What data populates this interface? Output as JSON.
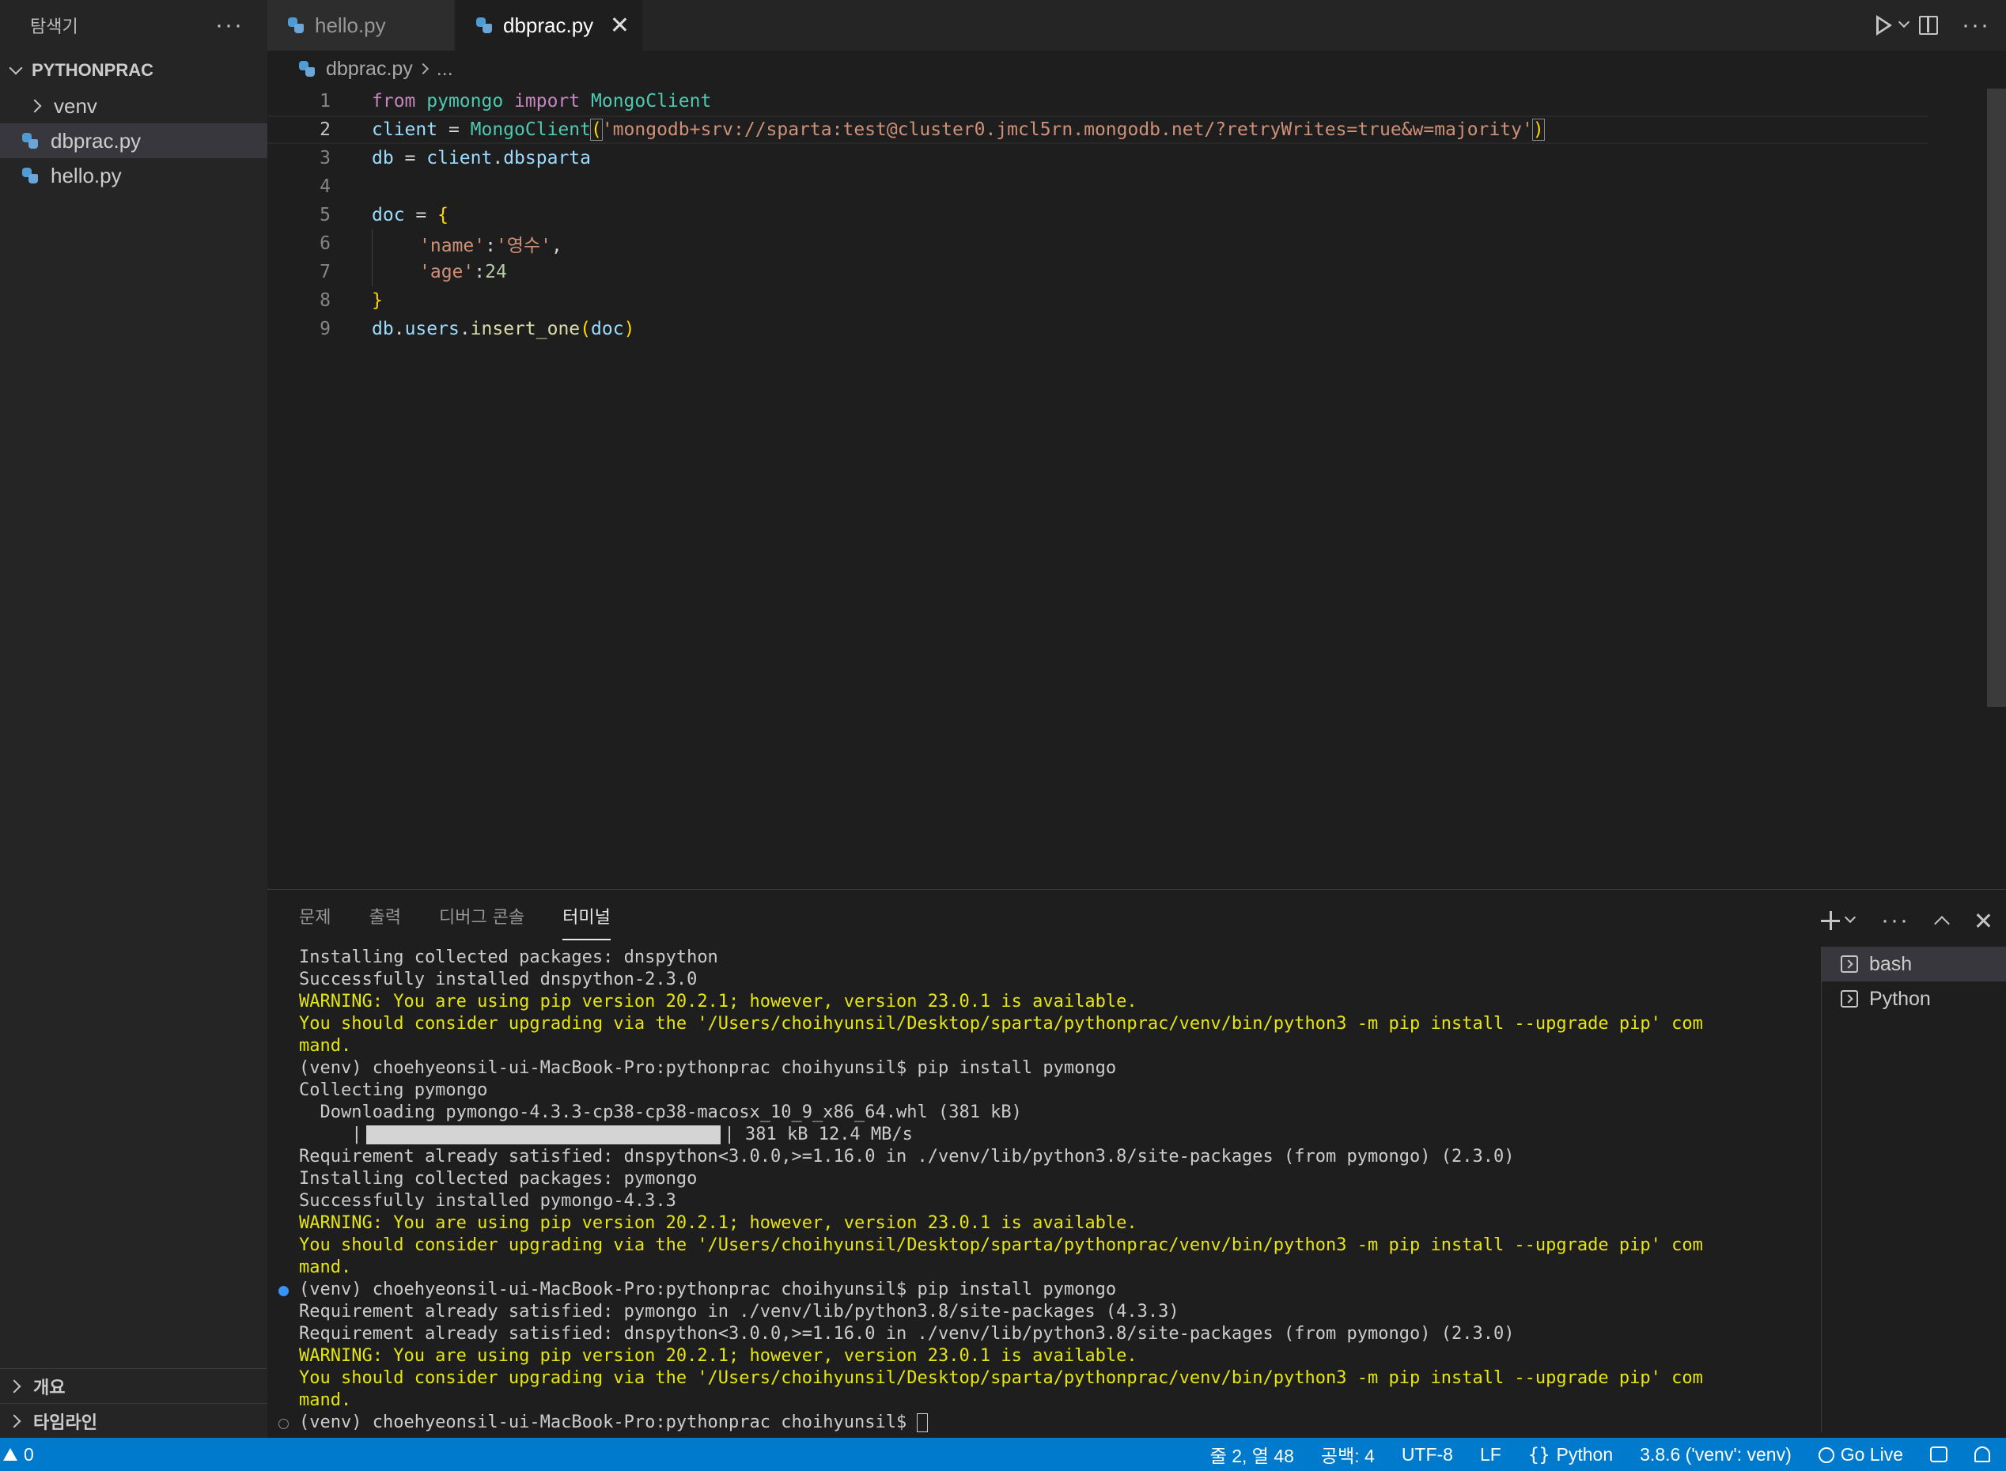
{
  "sidebar": {
    "title": "탐색기",
    "more": "···",
    "section": "PYTHONPRAC",
    "items": [
      {
        "label": "venv",
        "type": "folder"
      },
      {
        "label": "dbprac.py",
        "type": "file",
        "selected": true
      },
      {
        "label": "hello.py",
        "type": "file"
      }
    ],
    "outline": "개요",
    "timeline": "타임라인"
  },
  "tabs": [
    {
      "label": "hello.py",
      "active": false
    },
    {
      "label": "dbprac.py",
      "active": true
    }
  ],
  "breadcrumb": {
    "file": "dbprac.py",
    "rest": "..."
  },
  "editor": {
    "current_line": 2,
    "lines": [
      {
        "n": "1"
      },
      {
        "n": "2"
      },
      {
        "n": "3"
      },
      {
        "n": "4"
      },
      {
        "n": "5"
      },
      {
        "n": "6"
      },
      {
        "n": "7"
      },
      {
        "n": "8"
      },
      {
        "n": "9"
      }
    ],
    "tokens": {
      "l1_from": "from",
      "l1_mod": "pymongo",
      "l1_import": "import",
      "l1_cls": "MongoClient",
      "l2_var": "client",
      "l2_eq": " = ",
      "l2_cls": "MongoClient",
      "l2_open": "(",
      "l2_str": "'mongodb+srv://sparta:test@cluster0.jmcl5rn.mongodb.net/?retryWrites=true&w=majority'",
      "l2_close": ")",
      "l3_var": "db",
      "l3_eq": " = ",
      "l3_obj": "client",
      "l3_dot": ".",
      "l3_attr": "dbsparta",
      "l5_var": "doc",
      "l5_eq": " = ",
      "l5_brace": "{",
      "l6_key": "'name'",
      "l6_colon": ":",
      "l6_val": "'영수'",
      "l6_comma": ",",
      "l7_key": "'age'",
      "l7_colon": ":",
      "l7_val": "24",
      "l8_brace": "}",
      "l9_db": "db",
      "l9_dot1": ".",
      "l9_users": "users",
      "l9_dot2": ".",
      "l9_fn": "insert_one",
      "l9_open": "(",
      "l9_arg": "doc",
      "l9_close": ")"
    }
  },
  "panel": {
    "tabs": [
      "문제",
      "출력",
      "디버그 콘솔",
      "터미널"
    ],
    "active_tab": "터미널",
    "terminal_lines": [
      {
        "text": "Installing collected packages: dnspython",
        "kind": "normal"
      },
      {
        "text": "Successfully installed dnspython-2.3.0",
        "kind": "normal"
      },
      {
        "text": "WARNING: You are using pip version 20.2.1; however, version 23.0.1 is available.",
        "kind": "warn"
      },
      {
        "text": "You should consider upgrading via the '/Users/choihyunsil/Desktop/sparta/pythonprac/venv/bin/python3 -m pip install --upgrade pip' com",
        "kind": "warn"
      },
      {
        "text": "mand.",
        "kind": "warn"
      },
      {
        "text": "(venv) choehyeonsil-ui-MacBook-Pro:pythonprac choihyunsil$ pip install pymongo",
        "kind": "normal"
      },
      {
        "text": "Collecting pymongo",
        "kind": "normal"
      },
      {
        "text": "  Downloading pymongo-4.3.3-cp38-cp38-macosx_10_9_x86_64.whl (381 kB)",
        "kind": "normal"
      },
      {
        "text": "381 kB 12.4 MB/s",
        "kind": "progress",
        "progress": 1.0
      },
      {
        "text": "Requirement already satisfied: dnspython<3.0.0,>=1.16.0 in ./venv/lib/python3.8/site-packages (from pymongo) (2.3.0)",
        "kind": "normal"
      },
      {
        "text": "Installing collected packages: pymongo",
        "kind": "normal"
      },
      {
        "text": "Successfully installed pymongo-4.3.3",
        "kind": "normal"
      },
      {
        "text": "WARNING: You are using pip version 20.2.1; however, version 23.0.1 is available.",
        "kind": "warn"
      },
      {
        "text": "You should consider upgrading via the '/Users/choihyunsil/Desktop/sparta/pythonprac/venv/bin/python3 -m pip install --upgrade pip' com",
        "kind": "warn"
      },
      {
        "text": "mand.",
        "kind": "warn"
      },
      {
        "text": "(venv) choehyeonsil-ui-MacBook-Pro:pythonprac choihyunsil$ pip install pymongo",
        "kind": "normal",
        "marker": "blue"
      },
      {
        "text": "Requirement already satisfied: pymongo in ./venv/lib/python3.8/site-packages (4.3.3)",
        "kind": "normal"
      },
      {
        "text": "Requirement already satisfied: dnspython<3.0.0,>=1.16.0 in ./venv/lib/python3.8/site-packages (from pymongo) (2.3.0)",
        "kind": "normal"
      },
      {
        "text": "WARNING: You are using pip version 20.2.1; however, version 23.0.1 is available.",
        "kind": "warn"
      },
      {
        "text": "You should consider upgrading via the '/Users/choihyunsil/Desktop/sparta/pythonprac/venv/bin/python3 -m pip install --upgrade pip' com",
        "kind": "warn"
      },
      {
        "text": "mand.",
        "kind": "warn"
      },
      {
        "text": "(venv) choehyeonsil-ui-MacBook-Pro:pythonprac choihyunsil$ ",
        "kind": "prompt",
        "marker": "empty"
      }
    ],
    "terminals": [
      {
        "label": "bash",
        "active": true
      },
      {
        "label": "Python",
        "active": false
      }
    ]
  },
  "statusbar": {
    "warnings": "0",
    "position": "줄 2, 열 48",
    "spaces": "공백: 4",
    "encoding": "UTF-8",
    "eol": "LF",
    "language": "Python",
    "interpreter": "3.8.6 ('venv': venv)",
    "golive": "Go Live"
  },
  "colors": {
    "statusbar": "#007acc",
    "warning_text": "#e5e510",
    "keyword": "#c586c0",
    "class": "#4ec9b0",
    "string": "#ce9178"
  },
  "icons": [
    "python-file-icon",
    "play-icon",
    "split-editor-icon",
    "more-icon",
    "close-icon",
    "plus-icon",
    "terminal-icon",
    "bell-icon",
    "broadcast-icon",
    "feedback-icon",
    "warning-icon"
  ]
}
